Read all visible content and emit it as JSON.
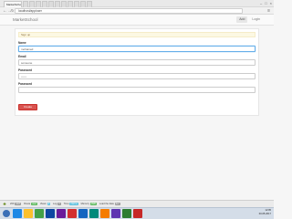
{
  "browser": {
    "tabs": [
      {
        "label": "MarketSchool",
        "active": true
      },
      {
        "label": "",
        "active": false
      },
      {
        "label": "",
        "active": false
      },
      {
        "label": "",
        "active": false
      },
      {
        "label": "",
        "active": false
      },
      {
        "label": "",
        "active": false
      },
      {
        "label": "",
        "active": false
      },
      {
        "label": "",
        "active": false
      },
      {
        "label": "",
        "active": false
      },
      {
        "label": "",
        "active": false
      },
      {
        "label": "",
        "active": false
      },
      {
        "label": "",
        "active": false
      }
    ],
    "url": "localhost/app/user",
    "back_icon": "back-arrow-icon",
    "forward_icon": "forward-arrow-icon",
    "refresh_icon": "refresh-icon",
    "menu_icon": "menu-icon"
  },
  "app": {
    "brand": "MarketSchool",
    "nav": {
      "add_label": "Add",
      "login_label": "Login"
    }
  },
  "form": {
    "alert": "Sign up",
    "name": {
      "label": "Name",
      "value": "mohamed",
      "placeholder": ""
    },
    "email": {
      "label": "Email",
      "value": "someone",
      "placeholder": ""
    },
    "password": {
      "label": "Password",
      "value": "",
      "placeholder": "••••••"
    },
    "password2": {
      "label": "Password",
      "value": "",
      "placeholder": ""
    },
    "submit_label": "Create"
  },
  "debugbar": {
    "items": [
      {
        "label": "200",
        "badge": "GET"
      },
      {
        "label": "Route",
        "badge": "user"
      },
      {
        "label": "Views",
        "badge": "3"
      },
      {
        "label": "Log",
        "badge": "0"
      },
      {
        "label": "Time",
        "badge": "212ms"
      },
      {
        "label": "Memory",
        "badge": "4MB"
      },
      {
        "label": "Load the data",
        "badge": "dev"
      }
    ]
  },
  "taskbar": {
    "apps": [
      "#1e88e5",
      "#fbc02d",
      "#43a047",
      "#0d47a1",
      "#6a1b9a",
      "#d32f2f",
      "#1565c0",
      "#00897b",
      "#f57c00",
      "#5e35b1",
      "#2e7d32",
      "#c62828"
    ],
    "time": "12:05",
    "date": "03-05-2017"
  }
}
